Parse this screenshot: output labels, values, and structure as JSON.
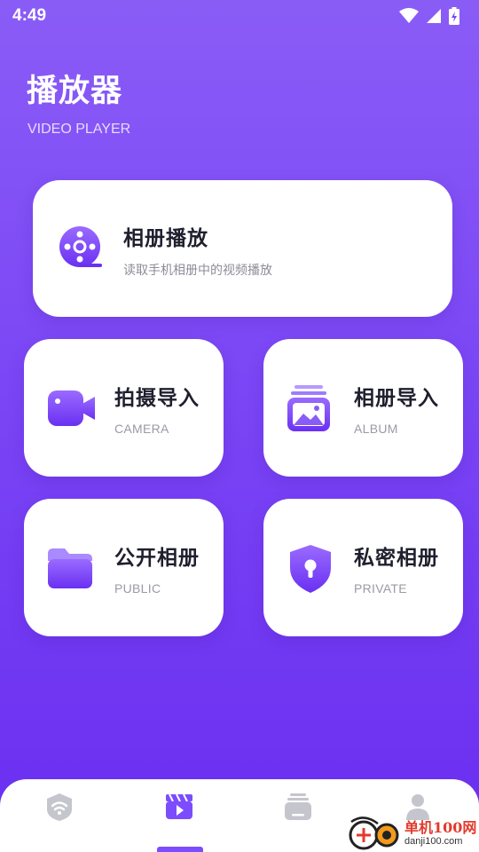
{
  "status": {
    "time": "4:49"
  },
  "header": {
    "title": "播放器",
    "subtitle": "VIDEO PLAYER"
  },
  "main_card": {
    "title": "相册播放",
    "description": "读取手机相册中的视频播放",
    "icon": "film-reel-icon"
  },
  "grid": [
    {
      "title": "拍摄导入",
      "subtitle": "CAMERA",
      "icon": "video-camera-icon"
    },
    {
      "title": "相册导入",
      "subtitle": "ALBUM",
      "icon": "photo-album-icon"
    },
    {
      "title": "公开相册",
      "subtitle": "PUBLIC",
      "icon": "folder-icon"
    },
    {
      "title": "私密相册",
      "subtitle": "PRIVATE",
      "icon": "shield-lock-icon"
    }
  ],
  "nav": [
    {
      "icon": "wifi-icon"
    },
    {
      "icon": "clapper-play-icon",
      "active": true
    },
    {
      "icon": "stack-icon"
    },
    {
      "icon": "person-icon"
    }
  ],
  "watermark": {
    "brand": "单机100网",
    "url": "danji100.com"
  },
  "colors": {
    "accent": "#7c4dff",
    "inactive": "#c5c5cd"
  }
}
